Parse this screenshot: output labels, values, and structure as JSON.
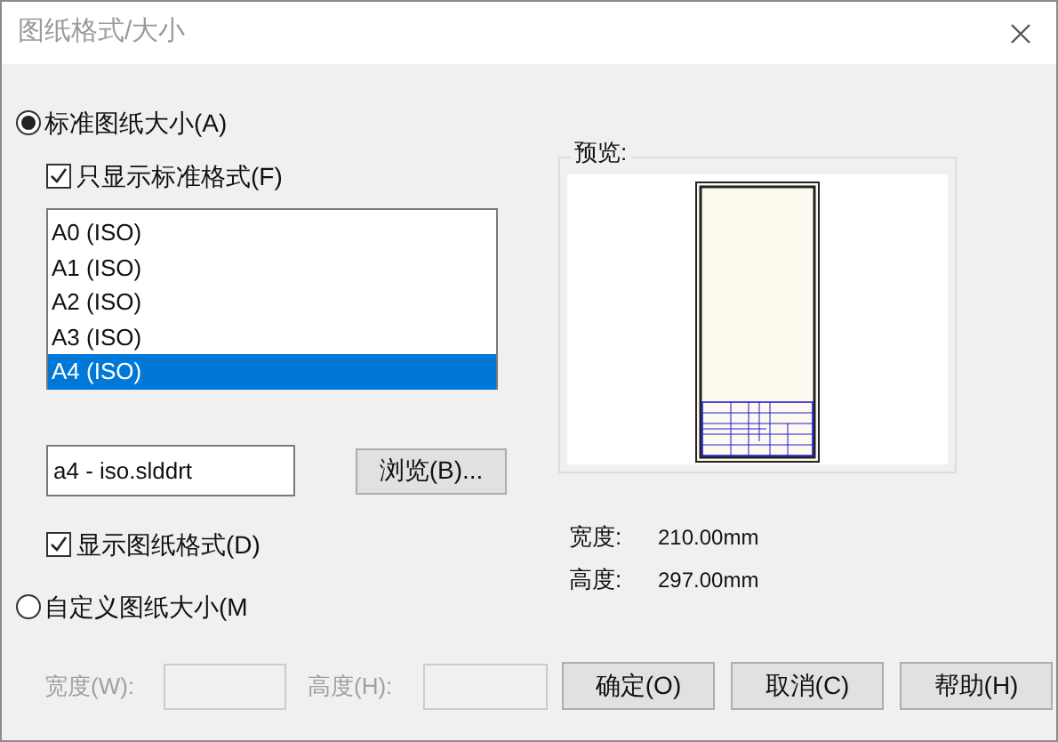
{
  "window": {
    "title": "图纸格式/大小"
  },
  "standard_size": {
    "label": "标准图纸大小(A)",
    "selected": true
  },
  "only_standard": {
    "label": "只显示标准格式(F)",
    "checked": true
  },
  "sizes": [
    {
      "label": "A0 (ISO)",
      "selected": false
    },
    {
      "label": "A1 (ISO)",
      "selected": false
    },
    {
      "label": "A2 (ISO)",
      "selected": false
    },
    {
      "label": "A3 (ISO)",
      "selected": false
    },
    {
      "label": "A4 (ISO)",
      "selected": true
    }
  ],
  "format_file": {
    "value": "a4 - iso.slddrt"
  },
  "browse_button": "浏览(B)...",
  "show_format": {
    "label": "显示图纸格式(D)",
    "checked": true
  },
  "custom_size": {
    "label": "自定义图纸大小(M",
    "selected": false
  },
  "custom_width": {
    "label": "宽度(W):",
    "disabled": true
  },
  "custom_height": {
    "label": "高度(H):",
    "disabled": true
  },
  "preview": {
    "label": "预览:",
    "width_label": "宽度:",
    "width": "210.00mm",
    "height_label": "高度:",
    "height": "297.00mm"
  },
  "buttons": [
    "确定(O)",
    "取消(C)",
    "帮助(H)"
  ]
}
